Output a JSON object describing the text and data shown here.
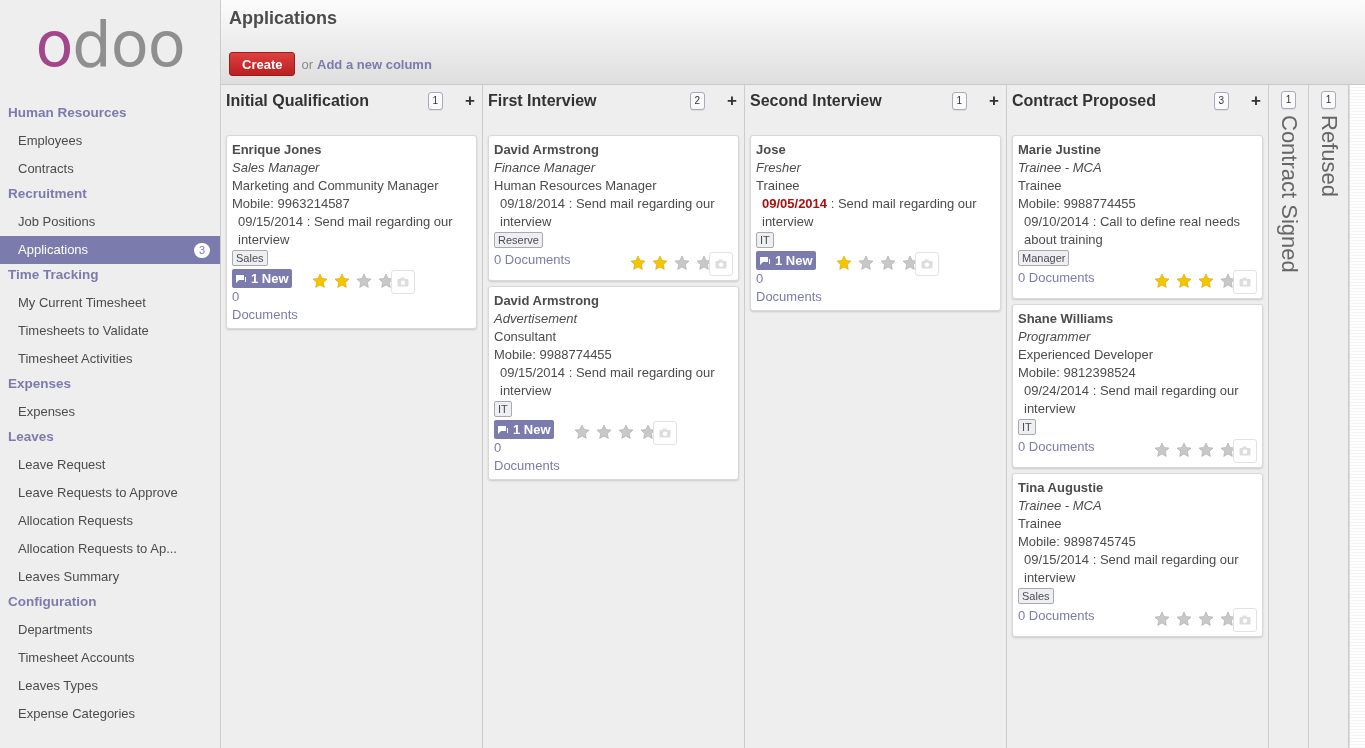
{
  "logo": "odoo",
  "sidebar": [
    {
      "title": "Human Resources",
      "items": [
        {
          "label": "Employees",
          "selected": false
        },
        {
          "label": "Contracts",
          "selected": false
        }
      ]
    },
    {
      "title": "Recruitment",
      "items": [
        {
          "label": "Job Positions",
          "selected": false
        },
        {
          "label": "Applications",
          "selected": true,
          "badge": "3"
        }
      ]
    },
    {
      "title": "Time Tracking",
      "items": [
        {
          "label": "My Current Timesheet",
          "selected": false
        },
        {
          "label": "Timesheets to Validate",
          "selected": false
        },
        {
          "label": "Timesheet Activities",
          "selected": false
        }
      ]
    },
    {
      "title": "Expenses",
      "items": [
        {
          "label": "Expenses",
          "selected": false
        }
      ]
    },
    {
      "title": "Leaves",
      "items": [
        {
          "label": "Leave Request",
          "selected": false
        },
        {
          "label": "Leave Requests to Approve",
          "selected": false
        },
        {
          "label": "Allocation Requests",
          "selected": false
        },
        {
          "label": "Allocation Requests to Ap...",
          "selected": false
        },
        {
          "label": "Leaves Summary",
          "selected": false
        }
      ]
    },
    {
      "title": "Configuration",
      "items": [
        {
          "label": "Departments",
          "selected": false
        },
        {
          "label": "Timesheet Accounts",
          "selected": false
        },
        {
          "label": "Leaves Types",
          "selected": false
        },
        {
          "label": "Expense Categories",
          "selected": false
        }
      ]
    }
  ],
  "header": {
    "title": "Applications",
    "create": "Create",
    "or": "or",
    "add_column": "Add a new column"
  },
  "columns": [
    {
      "title": "Initial Qualification",
      "count": "1",
      "add": "+",
      "folded": false,
      "cards": [
        {
          "name": "Enrique Jones",
          "source": "Sales Manager",
          "job": "Marketing and Community Manager",
          "mobile": "Mobile: 9963214587",
          "activity_date": "09/15/2014",
          "overdue": false,
          "activity": " : Send mail regarding our interview",
          "tag": "Sales",
          "new_messages": "1 New",
          "documents": "0 Documents",
          "stars": 2
        }
      ]
    },
    {
      "title": "First Interview",
      "count": "2",
      "add": "+",
      "folded": false,
      "cards": [
        {
          "name": "David Armstrong",
          "source": "Finance Manager",
          "job": "Human Resources Manager",
          "activity_date": "09/18/2014",
          "overdue": false,
          "activity": " : Send mail regarding our interview",
          "tag": "Reserve",
          "documents": "0 Documents",
          "stars": 2
        },
        {
          "name": "David Armstrong",
          "source": "Advertisement",
          "job": "Consultant",
          "mobile": "Mobile: 9988774455",
          "activity_date": "09/15/2014",
          "overdue": false,
          "activity": " : Send mail regarding our interview",
          "tag": "IT",
          "new_messages": "1 New",
          "documents": "0 Documents",
          "stars": 0
        }
      ]
    },
    {
      "title": "Second Interview",
      "count": "1",
      "add": "+",
      "folded": false,
      "cards": [
        {
          "name": "Jose",
          "source": "Fresher",
          "job": "Trainee",
          "activity_date": "09/05/2014",
          "overdue": true,
          "activity": " : Send mail regarding our interview",
          "tag": "IT",
          "new_messages": "1 New",
          "documents": "0 Documents",
          "stars": 1
        }
      ]
    },
    {
      "title": "Contract Proposed",
      "count": "3",
      "add": "+",
      "folded": false,
      "cards": [
        {
          "name": "Marie Justine",
          "source": "Trainee - MCA",
          "job": "Trainee",
          "mobile": "Mobile: 9988774455",
          "activity_date": "09/10/2014",
          "overdue": false,
          "activity": " : Call to define real needs about training",
          "tag": "Manager",
          "documents": "0 Documents",
          "stars": 3
        },
        {
          "name": "Shane Williams",
          "source": "Programmer",
          "job": "Experienced Developer",
          "mobile": "Mobile: 9812398524",
          "activity_date": "09/24/2014",
          "overdue": false,
          "activity": " : Send mail regarding our interview",
          "tag": "IT",
          "documents": "0 Documents",
          "stars": 0
        },
        {
          "name": "Tina Augustie",
          "source": "Trainee - MCA",
          "job": "Trainee",
          "mobile": "Mobile: 9898745745",
          "activity_date": "09/15/2014",
          "overdue": false,
          "activity": " : Send mail regarding our interview",
          "tag": "Sales",
          "documents": "0 Documents",
          "stars": 0
        }
      ]
    },
    {
      "title": "Contract Signed",
      "count": "1",
      "folded": true
    },
    {
      "title": "Refused",
      "count": "1",
      "folded": true
    }
  ]
}
